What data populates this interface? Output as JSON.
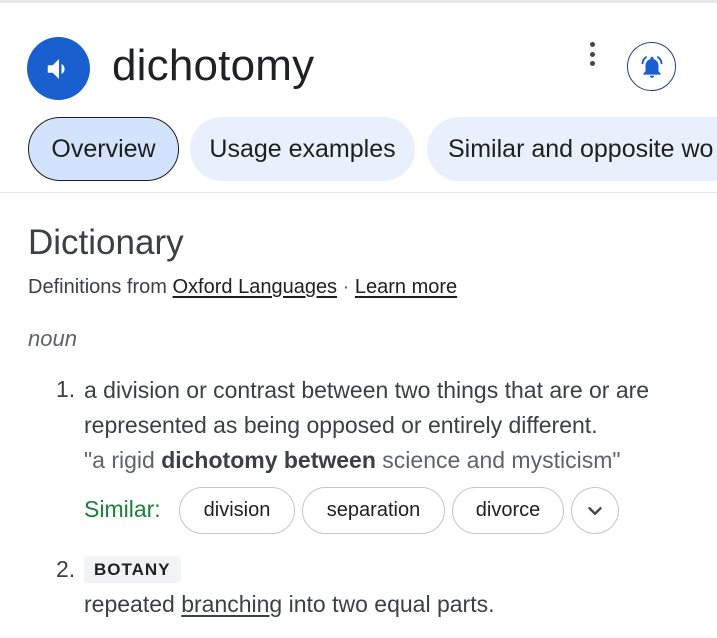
{
  "header": {
    "word": "dichotomy",
    "speaker_icon": "volume-up-icon",
    "more_icon": "more-vert-icon",
    "bell_icon": "notification-bell-icon",
    "accent_color": "#1a5fd0"
  },
  "tabs": [
    {
      "label": "Overview",
      "active": true
    },
    {
      "label": "Usage examples",
      "active": false
    },
    {
      "label": "Similar and opposite wo",
      "active": false
    }
  ],
  "dictionary": {
    "title": "Dictionary",
    "source_prefix": "Definitions from",
    "source_link": "Oxford Languages",
    "separator": "·",
    "learn_more": "Learn more",
    "part_of_speech": "noun",
    "senses": [
      {
        "number": "1.",
        "definition": "a division or contrast between two things that are or are represented as being opposed or entirely different.",
        "example": {
          "open_quote": "\"a rigid ",
          "bold": "dichotomy between",
          "rest": " science and mysticism\""
        },
        "similar_label": "Similar:",
        "similar": [
          "division",
          "separation",
          "divorce"
        ],
        "expand_icon": "chevron-down-icon"
      },
      {
        "number": "2.",
        "domain": "BOTANY",
        "definition_before": "repeated ",
        "definition_link": "branching",
        "definition_after": " into two equal parts."
      }
    ],
    "similar_color": "#188038"
  }
}
